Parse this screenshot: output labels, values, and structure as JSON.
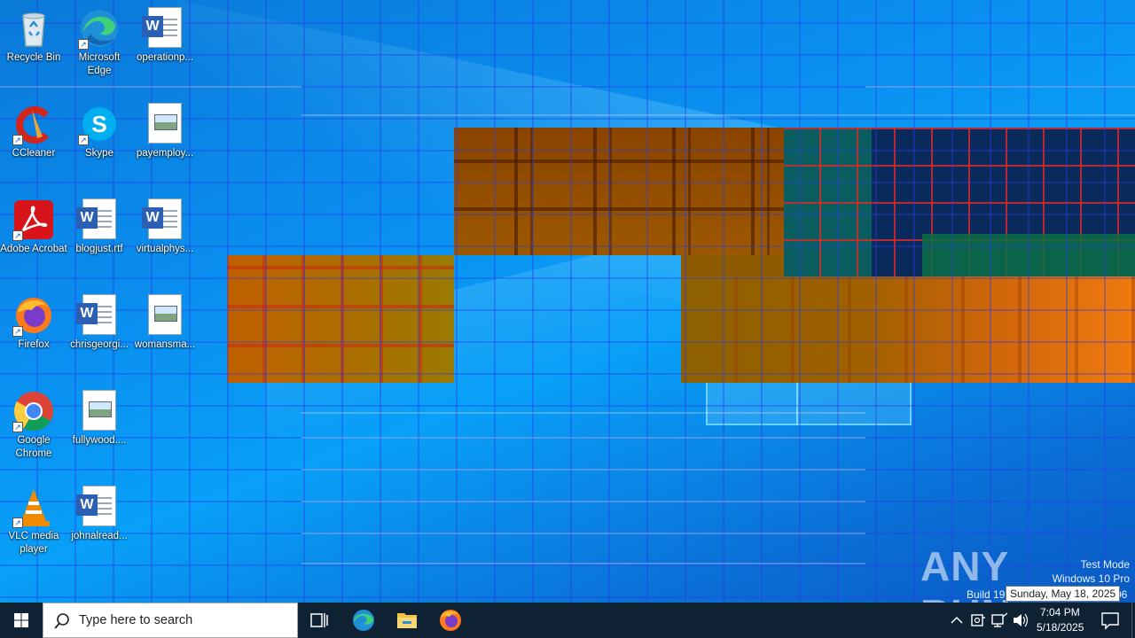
{
  "desktop": {
    "icons": [
      {
        "label": "Recycle Bin",
        "icon": "recycle-bin-icon"
      },
      {
        "label": "Microsoft Edge",
        "icon": "edge-icon"
      },
      {
        "label": "operationp...",
        "icon": "word-document-icon"
      },
      {
        "label": "CCleaner",
        "icon": "ccleaner-icon"
      },
      {
        "label": "Skype",
        "icon": "skype-icon"
      },
      {
        "label": "payemploy...",
        "icon": "image-file-icon"
      },
      {
        "label": "Adobe Acrobat",
        "icon": "adobe-acrobat-icon"
      },
      {
        "label": "blogjust.rtf",
        "icon": "word-document-icon"
      },
      {
        "label": "virtualphys...",
        "icon": "word-document-icon"
      },
      {
        "label": "Firefox",
        "icon": "firefox-icon"
      },
      {
        "label": "chrisgeorgi...",
        "icon": "word-document-icon"
      },
      {
        "label": "womansma...",
        "icon": "image-file-icon"
      },
      {
        "label": "Google Chrome",
        "icon": "chrome-icon"
      },
      {
        "label": "fullywood....",
        "icon": "image-file-icon"
      },
      {
        "label": "VLC media player",
        "icon": "vlc-icon"
      },
      {
        "label": "johnalread...",
        "icon": "word-document-icon"
      }
    ]
  },
  "watermark": {
    "brand": "ANY RUN",
    "mode": "Test Mode",
    "os": "Windows 10 Pro",
    "build_prefix": "Build 19",
    "build_suffix": "06"
  },
  "tooltip": {
    "text": "Sunday, May 18, 2025"
  },
  "taskbar": {
    "search_placeholder": "Type here to search",
    "pinned": [
      "task-view-icon",
      "edge-icon",
      "file-explorer-icon",
      "firefox-icon"
    ],
    "clock": {
      "time": "7:04 PM",
      "date": "5/18/2025"
    },
    "colors": {
      "bar": "#0e2233",
      "accent": "#0078d7"
    }
  }
}
